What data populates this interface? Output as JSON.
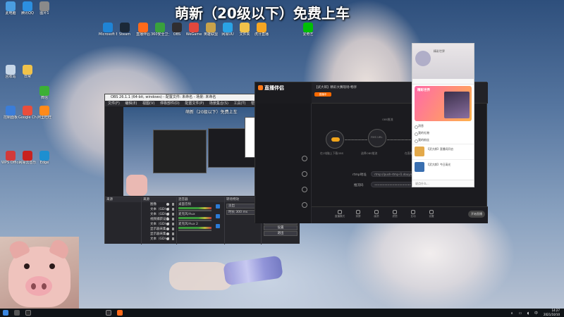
{
  "overlay_title": "萌新（20级以下）免费上车",
  "desktop_icons_left": [
    {
      "label": "此电脑",
      "color": "#4a9de0"
    },
    {
      "label": "腾讯QQ",
      "color": "#2c8fe0"
    },
    {
      "label": "图片1",
      "color": "#8a8a8a"
    },
    {
      "label": "回收站",
      "color": "#c7d7e8"
    },
    {
      "label": "日常",
      "color": "#f0c24a"
    },
    {
      "label": "微信",
      "color": "#3cb035"
    },
    {
      "label": "控制面板",
      "color": "#3b7dd8"
    },
    {
      "label": "Google Chrome",
      "color": "#e94e3c"
    },
    {
      "label": "阿里旺旺",
      "color": "#ff8a1a"
    },
    {
      "label": "WPS Office",
      "color": "#d23a3a"
    },
    {
      "label": "网易云音乐",
      "color": "#c8221f"
    },
    {
      "label": "Edge",
      "color": "#1e8fd0"
    }
  ],
  "desktop_icons_top": [
    {
      "label": "Microsoft Edge",
      "color": "#1f84d6"
    },
    {
      "label": "Steam",
      "color": "#1b2838"
    },
    {
      "label": "直播伴侣",
      "color": "#ff6a1a"
    },
    {
      "label": "360安全卫士",
      "color": "#39a13c"
    },
    {
      "label": "OBS",
      "color": "#302e31"
    },
    {
      "label": "WeGame",
      "color": "#e2483d"
    },
    {
      "label": "英雄联盟",
      "color": "#c9a24a"
    },
    {
      "label": "网易UU",
      "color": "#2aa3e5"
    },
    {
      "label": "文件夹",
      "color": "#f0c24a"
    },
    {
      "label": "虎牙直播",
      "color": "#f5a623"
    },
    {
      "label": "爱奇艺",
      "color": "#00be06"
    }
  ],
  "obs": {
    "title": "OBS 26.1.1 (64-bit, windows) - 配置文件: 未命名 - 场景: 未命名",
    "menu": [
      "文件(F)",
      "编辑(E)",
      "视图(V)",
      "停靠部件(D)",
      "配置文件(P)",
      "场景集合(S)",
      "工具(T)",
      "帮助(H)"
    ],
    "preview_title": "萌新（20级以下）免费上车",
    "docks": {
      "scenes": "来源",
      "sources_header": "来源",
      "sources": [
        "图像",
        "文本（GDI+）",
        "文本（GDI+）",
        "视频捕获设备",
        "文本（GDI+）",
        "显示器采集",
        "显示器采集",
        "文本（GDI+）"
      ],
      "mixer_header": "混音器",
      "mixer": [
        "桌面音频",
        "麦克风/Aux",
        "麦克风/Aux 2"
      ],
      "transition_header": "转场特效",
      "transition_value": "淡出",
      "duration_label": "时长",
      "duration_value": "300 ms",
      "controls_header": "控件",
      "controls": [
        "开始推流",
        "开始录制",
        "启动虚拟摄像机",
        "工作室模式",
        "设置",
        "退出"
      ]
    },
    "window_controls": "– □ ×"
  },
  "companion": {
    "logo": "直播伴侣",
    "room_title": "【武大郎】精彩大赛现场-畅享",
    "badge": "直播中",
    "flow_labels": [
      "在1电脑上下载OBS",
      "选择OBS推流",
      "在直播伴侣开播",
      "OBS推流"
    ],
    "flow_center_label": "FMS URL",
    "rtmp_label": "rtmp地址",
    "key_label": "推流码",
    "rtmp_value": "rtmp://push-rtmp-l1.douyincdn.com/third",
    "key_value": "••••••••••••••••••••••",
    "tools": [
      "直播模式",
      "录屏",
      "画质",
      "滤镜",
      "互动",
      "设置"
    ],
    "start_button": "开始直播"
  },
  "phone": {
    "header": "精彩世界",
    "banner_text": "精彩世界",
    "list_items": [
      "消息",
      "我的礼物",
      "我的粉丝"
    ],
    "feed": [
      "【武大郎】直播间开启",
      "【武大郎】今日高光"
    ],
    "footer": "说点什么..."
  },
  "taskbar": {
    "clock_time": "14:27",
    "clock_date": "2021/10/10",
    "tray": "∧ ▭ ◖ 中"
  }
}
